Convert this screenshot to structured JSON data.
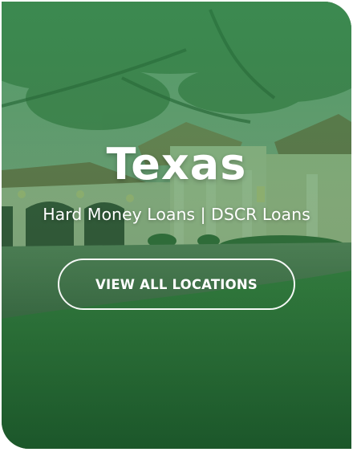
{
  "card": {
    "title": "Texas",
    "subtitle": "Hard Money Loans | DSCR Loans",
    "cta_label": "VIEW ALL LOCATIONS"
  },
  "colors": {
    "overlay": "#26964e",
    "text": "#ffffff"
  }
}
